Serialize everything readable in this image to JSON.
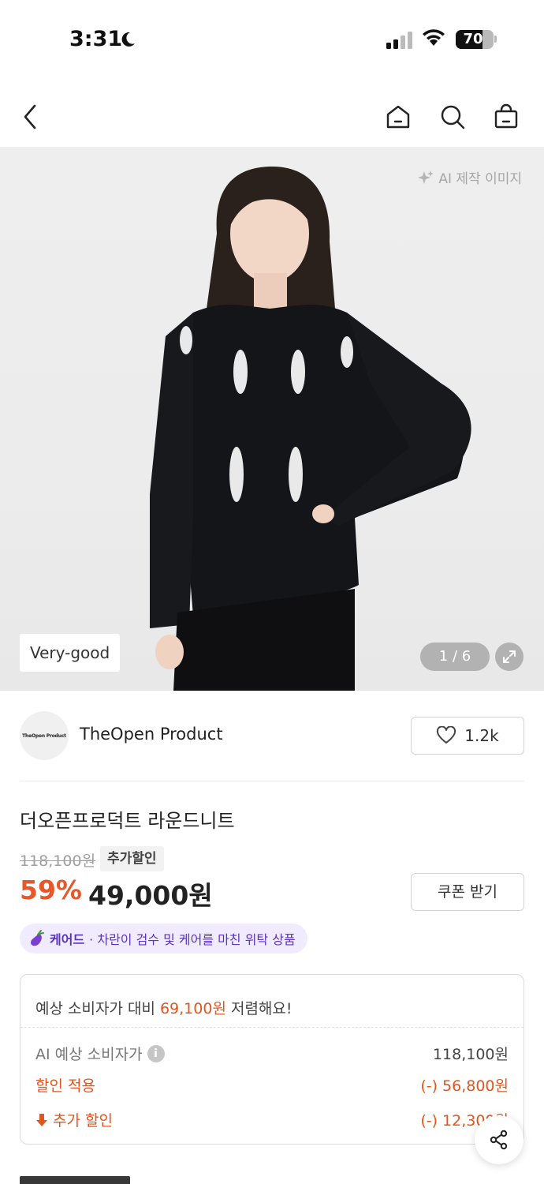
{
  "status_bar": {
    "time": "3:31",
    "battery": "70",
    "battery_level_percent": 70
  },
  "nav": {
    "back_icon": "chevron-left-icon",
    "home_icon": "home-icon",
    "search_icon": "search-icon",
    "cart_icon": "shopping-bag-icon"
  },
  "hero": {
    "ai_label": "AI 제작 이미지",
    "grade_badge": "Very-good",
    "pager": "1 / 6"
  },
  "seller": {
    "logo_text": "TheOpen Product",
    "name": "TheOpen Product",
    "likes": "1.2k"
  },
  "product": {
    "title": "더오픈프로덕트 라운드니트",
    "original_price": "118,100원",
    "extra_discount_tag": "추가할인",
    "discount_percent": "59%",
    "price": "49,000원",
    "coupon_button": "쿠폰 받기"
  },
  "care_badge": {
    "brand": "케어드",
    "text": "· 차란이 검수 및 케어를 마친 위탁 상품"
  },
  "savings": {
    "headline_prefix": "예상 소비자가 대비 ",
    "headline_amount": "69,100원",
    "headline_suffix": " 저렴해요!",
    "rows": [
      {
        "label": "AI 예상 소비자가",
        "value": "118,100원"
      },
      {
        "label": "할인 적용",
        "value": "(-) 56,800원"
      },
      {
        "label": "추가 할인",
        "value": "(-) 12,300원"
      }
    ]
  },
  "colors": {
    "accent": "#e8572a",
    "care_bg": "#f1ebff",
    "care_text": "#5a35b8"
  }
}
